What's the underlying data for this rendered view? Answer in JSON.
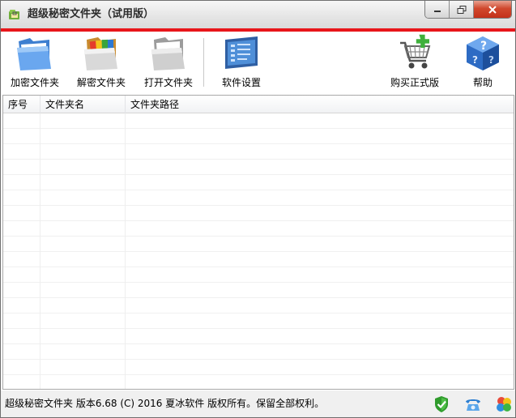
{
  "window": {
    "title": "超级秘密文件夹（试用版）"
  },
  "toolbar": {
    "encrypt_label": "加密文件夹",
    "decrypt_label": "解密文件夹",
    "open_label": "打开文件夹",
    "settings_label": "软件设置",
    "buy_label": "购买正式版",
    "help_label": "帮助"
  },
  "list": {
    "columns": [
      "序号",
      "文件夹名",
      "文件夹路径"
    ],
    "rows": []
  },
  "status": {
    "text": "超级秘密文件夹 版本6.68 (C) 2016 夏冰软件 版权所有。保留全部权利。"
  },
  "colors": {
    "accent_red": "#e8161b",
    "close_button": "#c4301a"
  }
}
